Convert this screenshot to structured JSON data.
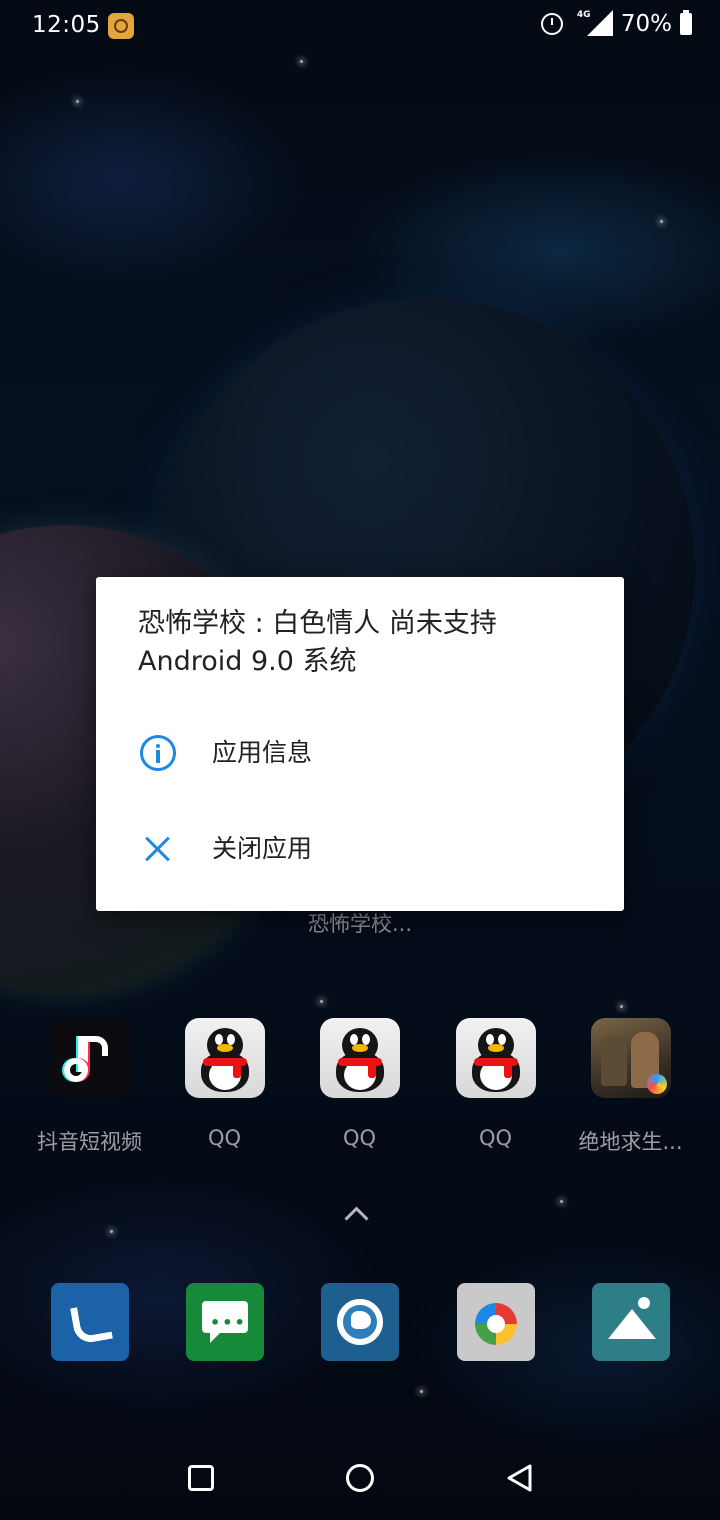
{
  "status_bar": {
    "time": "12:05",
    "network": "4G",
    "battery": "70%",
    "icons": [
      "app-notification-icon",
      "alarm-icon",
      "data-arrows-icon",
      "cellular-signal-icon",
      "battery-icon"
    ]
  },
  "dialog": {
    "title": "恐怖学校 : 白色情人 尚未支持 Android 9.0 系统",
    "items": [
      {
        "label": "应用信息",
        "icon": "info-icon"
      },
      {
        "label": "关闭应用",
        "icon": "close-icon"
      }
    ],
    "accent_color": "#1e88e5"
  },
  "home": {
    "partial_label": "恐怖学校...",
    "apps": [
      {
        "label": "抖音短视频",
        "icon": "tiktok-icon"
      },
      {
        "label": "QQ",
        "icon": "qq-icon"
      },
      {
        "label": "QQ",
        "icon": "qq-icon"
      },
      {
        "label": "QQ",
        "icon": "qq-icon"
      },
      {
        "label": "绝地求生...",
        "icon": "pubg-game-icon"
      }
    ],
    "dock": [
      {
        "icon": "phone-icon"
      },
      {
        "icon": "messages-icon"
      },
      {
        "icon": "browser-icon"
      },
      {
        "icon": "camera-icon"
      },
      {
        "icon": "gallery-icon"
      }
    ]
  },
  "nav_bar": {
    "icons": [
      "recents-icon",
      "home-icon",
      "back-icon"
    ]
  }
}
